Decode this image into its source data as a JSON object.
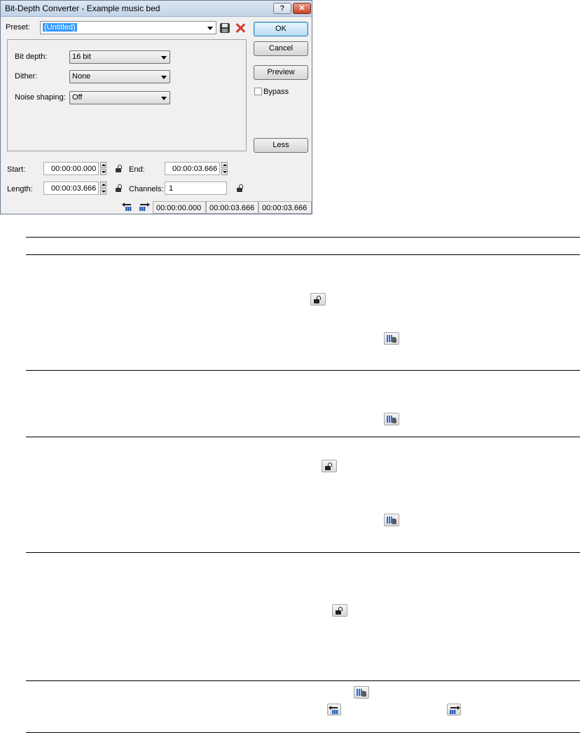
{
  "dialog": {
    "title": "Bit-Depth Converter - Example music bed",
    "help_label": "?",
    "close_label": "✕",
    "preset": {
      "label": "Preset:",
      "value": "(Untitled)"
    },
    "buttons": {
      "ok": "OK",
      "cancel": "Cancel",
      "preview": "Preview",
      "less": "Less"
    },
    "bypass": {
      "label": "Bypass",
      "checked": false
    },
    "settings": {
      "bit_depth": {
        "label": "Bit depth:",
        "value": "16 bit"
      },
      "dither": {
        "label": "Dither:",
        "value": "None"
      },
      "noise_shaping": {
        "label": "Noise shaping:",
        "value": "Off"
      }
    },
    "selection": {
      "start": {
        "label": "Start:",
        "value": "00:00:00.000"
      },
      "end": {
        "label": "End:",
        "value": "00:00:03.666"
      },
      "length": {
        "label": "Length:",
        "value": "00:00:03.666"
      },
      "channels": {
        "label": "Channels:",
        "value": "1"
      }
    },
    "status_bar": [
      "00:00:00.000",
      "00:00:03.666",
      "00:00:03.666"
    ]
  }
}
